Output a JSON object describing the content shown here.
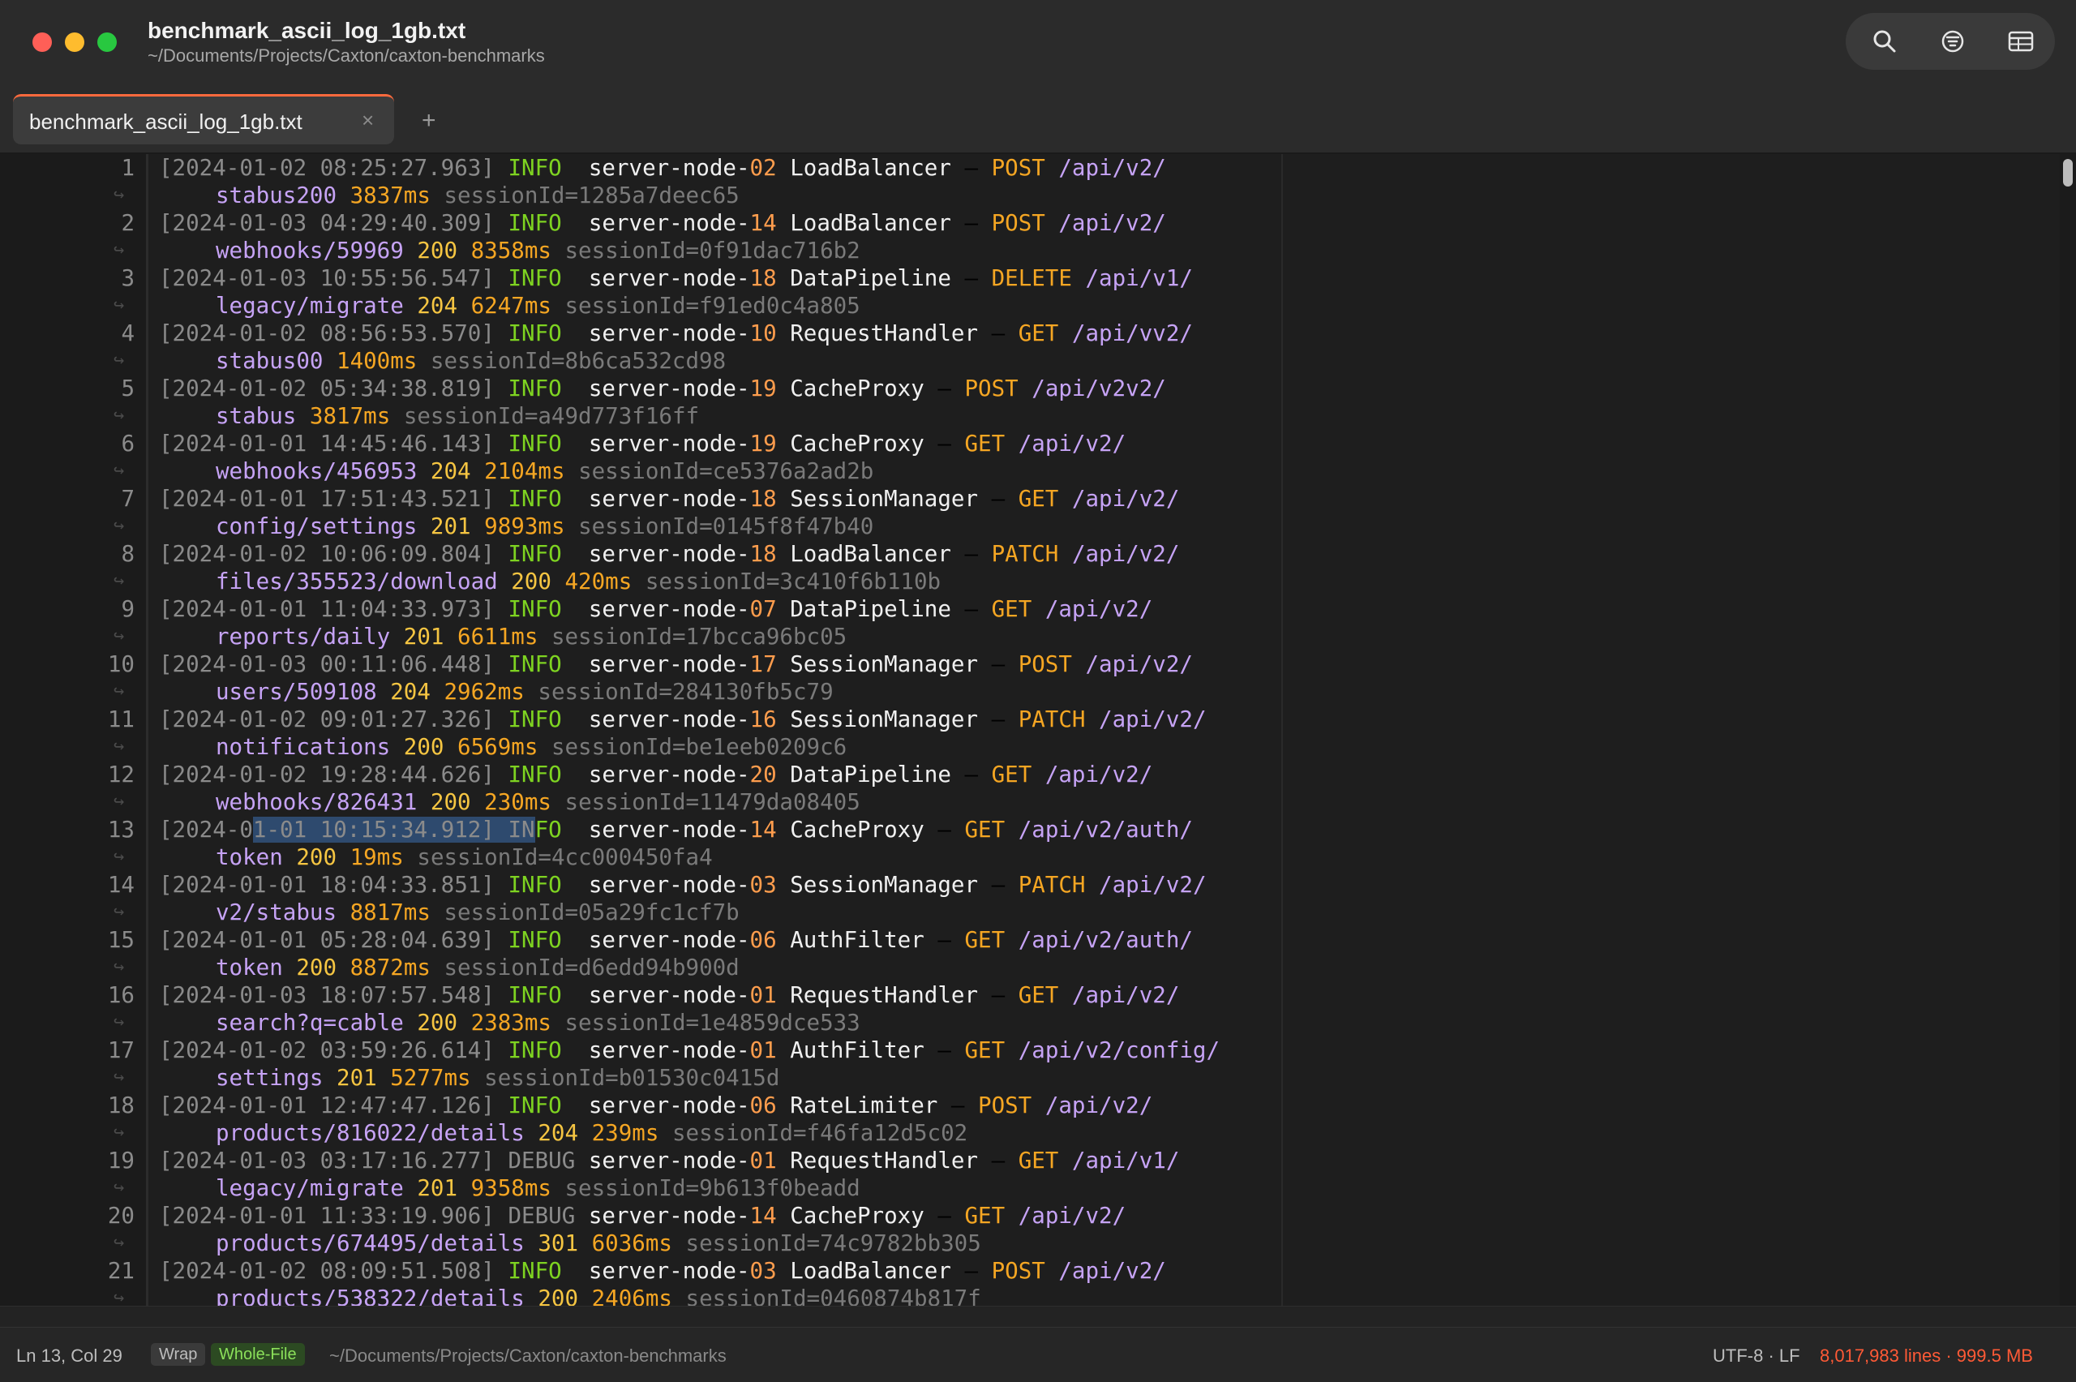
{
  "window": {
    "title": "benchmark_ascii_log_1gb.txt",
    "subtitle": "~/Documents/Projects/Caxton/caxton-benchmarks"
  },
  "toolbar": {
    "icons": [
      "search-icon",
      "filter-icon",
      "table-icon"
    ]
  },
  "tabs": [
    {
      "label": "benchmark_ascii_log_1gb.txt",
      "close": "×",
      "active": true
    }
  ],
  "tab_add": "+",
  "lines": [
    {
      "n": "1",
      "ts": "[2024-01-02 08:25:27.963]",
      "lvl": "INFO",
      "node": "server-node-",
      "nn": "02",
      "svc": "LoadBalancer",
      "method": "POST",
      "path1": "/api/v2/",
      "path2": "stabus200",
      "status": "",
      "dur": "3837ms",
      "sess": "sessionId=1285a7deec65"
    },
    {
      "n": "2",
      "ts": "[2024-01-03 04:29:40.309]",
      "lvl": "INFO",
      "node": "server-node-",
      "nn": "14",
      "svc": "LoadBalancer",
      "method": "POST",
      "path1": "/api/v2/",
      "path2": "webhooks/59969",
      "status": "200",
      "dur": "8358ms",
      "sess": "sessionId=0f91dac716b2"
    },
    {
      "n": "3",
      "ts": "[2024-01-03 10:55:56.547]",
      "lvl": "INFO",
      "node": "server-node-",
      "nn": "18",
      "svc": "DataPipeline",
      "method": "DELETE",
      "path1": "/api/v1/",
      "path2": "legacy/migrate",
      "status": "204",
      "dur": "6247ms",
      "sess": "sessionId=f91ed0c4a805"
    },
    {
      "n": "4",
      "ts": "[2024-01-02 08:56:53.570]",
      "lvl": "INFO",
      "node": "server-node-",
      "nn": "10",
      "svc": "RequestHandler",
      "method": "GET",
      "path1": "/api/vv2/",
      "path2": "stabus00",
      "status": "",
      "dur": "1400ms",
      "sess": "sessionId=8b6ca532cd98"
    },
    {
      "n": "5",
      "ts": "[2024-01-02 05:34:38.819]",
      "lvl": "INFO",
      "node": "server-node-",
      "nn": "19",
      "svc": "CacheProxy",
      "method": "POST",
      "path1": "/api/v2v2/",
      "path2": "stabus",
      "status": "",
      "dur": "3817ms",
      "sess": "sessionId=a49d773f16ff"
    },
    {
      "n": "6",
      "ts": "[2024-01-01 14:45:46.143]",
      "lvl": "INFO",
      "node": "server-node-",
      "nn": "19",
      "svc": "CacheProxy",
      "method": "GET",
      "path1": "/api/v2/",
      "path2": "webhooks/456953",
      "status": "204",
      "dur": "2104ms",
      "sess": "sessionId=ce5376a2ad2b"
    },
    {
      "n": "7",
      "ts": "[2024-01-01 17:51:43.521]",
      "lvl": "INFO",
      "node": "server-node-",
      "nn": "18",
      "svc": "SessionManager",
      "method": "GET",
      "path1": "/api/v2/",
      "path2": "config/settings",
      "status": "201",
      "dur": "9893ms",
      "sess": "sessionId=0145f8f47b40"
    },
    {
      "n": "8",
      "ts": "[2024-01-02 10:06:09.804]",
      "lvl": "INFO",
      "node": "server-node-",
      "nn": "18",
      "svc": "LoadBalancer",
      "method": "PATCH",
      "path1": "/api/v2/",
      "path2": "files/355523/download",
      "status": "200",
      "dur": "420ms",
      "sess": "sessionId=3c410f6b110b"
    },
    {
      "n": "9",
      "ts": "[2024-01-01 11:04:33.973]",
      "lvl": "INFO",
      "node": "server-node-",
      "nn": "07",
      "svc": "DataPipeline",
      "method": "GET",
      "path1": "/api/v2/",
      "path2": "reports/daily",
      "status": "201",
      "dur": "6611ms",
      "sess": "sessionId=17bcca96bc05"
    },
    {
      "n": "10",
      "ts": "[2024-01-03 00:11:06.448]",
      "lvl": "INFO",
      "node": "server-node-",
      "nn": "17",
      "svc": "SessionManager",
      "method": "POST",
      "path1": "/api/v2/",
      "path2": "users/509108",
      "status": "204",
      "dur": "2962ms",
      "sess": "sessionId=284130fb5c79"
    },
    {
      "n": "11",
      "ts": "[2024-01-02 09:01:27.326]",
      "lvl": "INFO",
      "node": "server-node-",
      "nn": "16",
      "svc": "SessionManager",
      "method": "PATCH",
      "path1": "/api/v2/",
      "path2": "notifications",
      "status": "200",
      "dur": "6569ms",
      "sess": "sessionId=be1eeb0209c6"
    },
    {
      "n": "12",
      "ts": "[2024-01-02 19:28:44.626]",
      "lvl": "INFO",
      "node": "server-node-",
      "nn": "20",
      "svc": "DataPipeline",
      "method": "GET",
      "path1": "/api/v2/",
      "path2": "webhooks/826431",
      "status": "200",
      "dur": "230ms",
      "sess": "sessionId=11479da08405"
    },
    {
      "n": "13",
      "ts_a": "[2024-0",
      "ts_b": "1-01 10:15:34.912] IN",
      "lvl_rest": "FO",
      "lvl": "INFO",
      "node": "server-node-",
      "nn": "14",
      "svc": "CacheProxy",
      "method": "GET",
      "path1": "/api/v2/auth/",
      "path2": "token",
      "status": "200",
      "dur": "19ms",
      "sess": "sessionId=4cc000450fa4",
      "selected": true
    },
    {
      "n": "14",
      "ts": "[2024-01-01 18:04:33.851]",
      "lvl": "INFO",
      "node": "server-node-",
      "nn": "03",
      "svc": "SessionManager",
      "method": "PATCH",
      "path1": "/api/v2/",
      "path2": "v2/stabus",
      "status": "",
      "dur": "8817ms",
      "sess": "sessionId=05a29fc1cf7b"
    },
    {
      "n": "15",
      "ts": "[2024-01-01 05:28:04.639]",
      "lvl": "INFO",
      "node": "server-node-",
      "nn": "06",
      "svc": "AuthFilter",
      "method": "GET",
      "path1": "/api/v2/auth/",
      "path2": "token",
      "status": "200",
      "dur": "8872ms",
      "sess": "sessionId=d6edd94b900d"
    },
    {
      "n": "16",
      "ts": "[2024-01-03 18:07:57.548]",
      "lvl": "INFO",
      "node": "server-node-",
      "nn": "01",
      "svc": "RequestHandler",
      "method": "GET",
      "path1": "/api/v2/",
      "path2": "search?q=cable",
      "status": "200",
      "dur": "2383ms",
      "sess": "sessionId=1e4859dce533"
    },
    {
      "n": "17",
      "ts": "[2024-01-02 03:59:26.614]",
      "lvl": "INFO",
      "node": "server-node-",
      "nn": "01",
      "svc": "AuthFilter",
      "method": "GET",
      "path1": "/api/v2/config/",
      "path2": "settings",
      "status": "201",
      "dur": "5277ms",
      "sess": "sessionId=b01530c0415d"
    },
    {
      "n": "18",
      "ts": "[2024-01-01 12:47:47.126]",
      "lvl": "INFO",
      "node": "server-node-",
      "nn": "06",
      "svc": "RateLimiter",
      "method": "POST",
      "path1": "/api/v2/",
      "path2": "products/816022/details",
      "status": "204",
      "dur": "239ms",
      "sess": "sessionId=f46fa12d5c02"
    },
    {
      "n": "19",
      "ts": "[2024-01-03 03:17:16.277]",
      "lvl": "DEBUG",
      "node": "server-node-",
      "nn": "01",
      "svc": "RequestHandler",
      "method": "GET",
      "path1": "/api/v1/",
      "path2": "legacy/migrate",
      "status": "201",
      "dur": "9358ms",
      "sess": "sessionId=9b613f0beadd"
    },
    {
      "n": "20",
      "ts": "[2024-01-01 11:33:19.906]",
      "lvl": "DEBUG",
      "node": "server-node-",
      "nn": "14",
      "svc": "CacheProxy",
      "method": "GET",
      "path1": "/api/v2/",
      "path2": "products/674495/details",
      "status": "301",
      "dur": "6036ms",
      "sess": "sessionId=74c9782bb305"
    },
    {
      "n": "21",
      "ts": "[2024-01-02 08:09:51.508]",
      "lvl": "INFO",
      "node": "server-node-",
      "nn": "03",
      "svc": "LoadBalancer",
      "method": "POST",
      "path1": "/api/v2/",
      "path2": "products/538322/details",
      "status": "200",
      "dur": "2406ms",
      "sess": "sessionId=0460874b817f"
    }
  ],
  "statusbar": {
    "position": "Ln 13, Col 29",
    "wrap": "Wrap",
    "whole_file": "Whole-File",
    "path": "~/Documents/Projects/Caxton/caxton-benchmarks",
    "encoding": "UTF-8 · LF",
    "stats": "8,017,983 lines · 999.5 MB",
    "stats_color": "#ff5a36"
  }
}
